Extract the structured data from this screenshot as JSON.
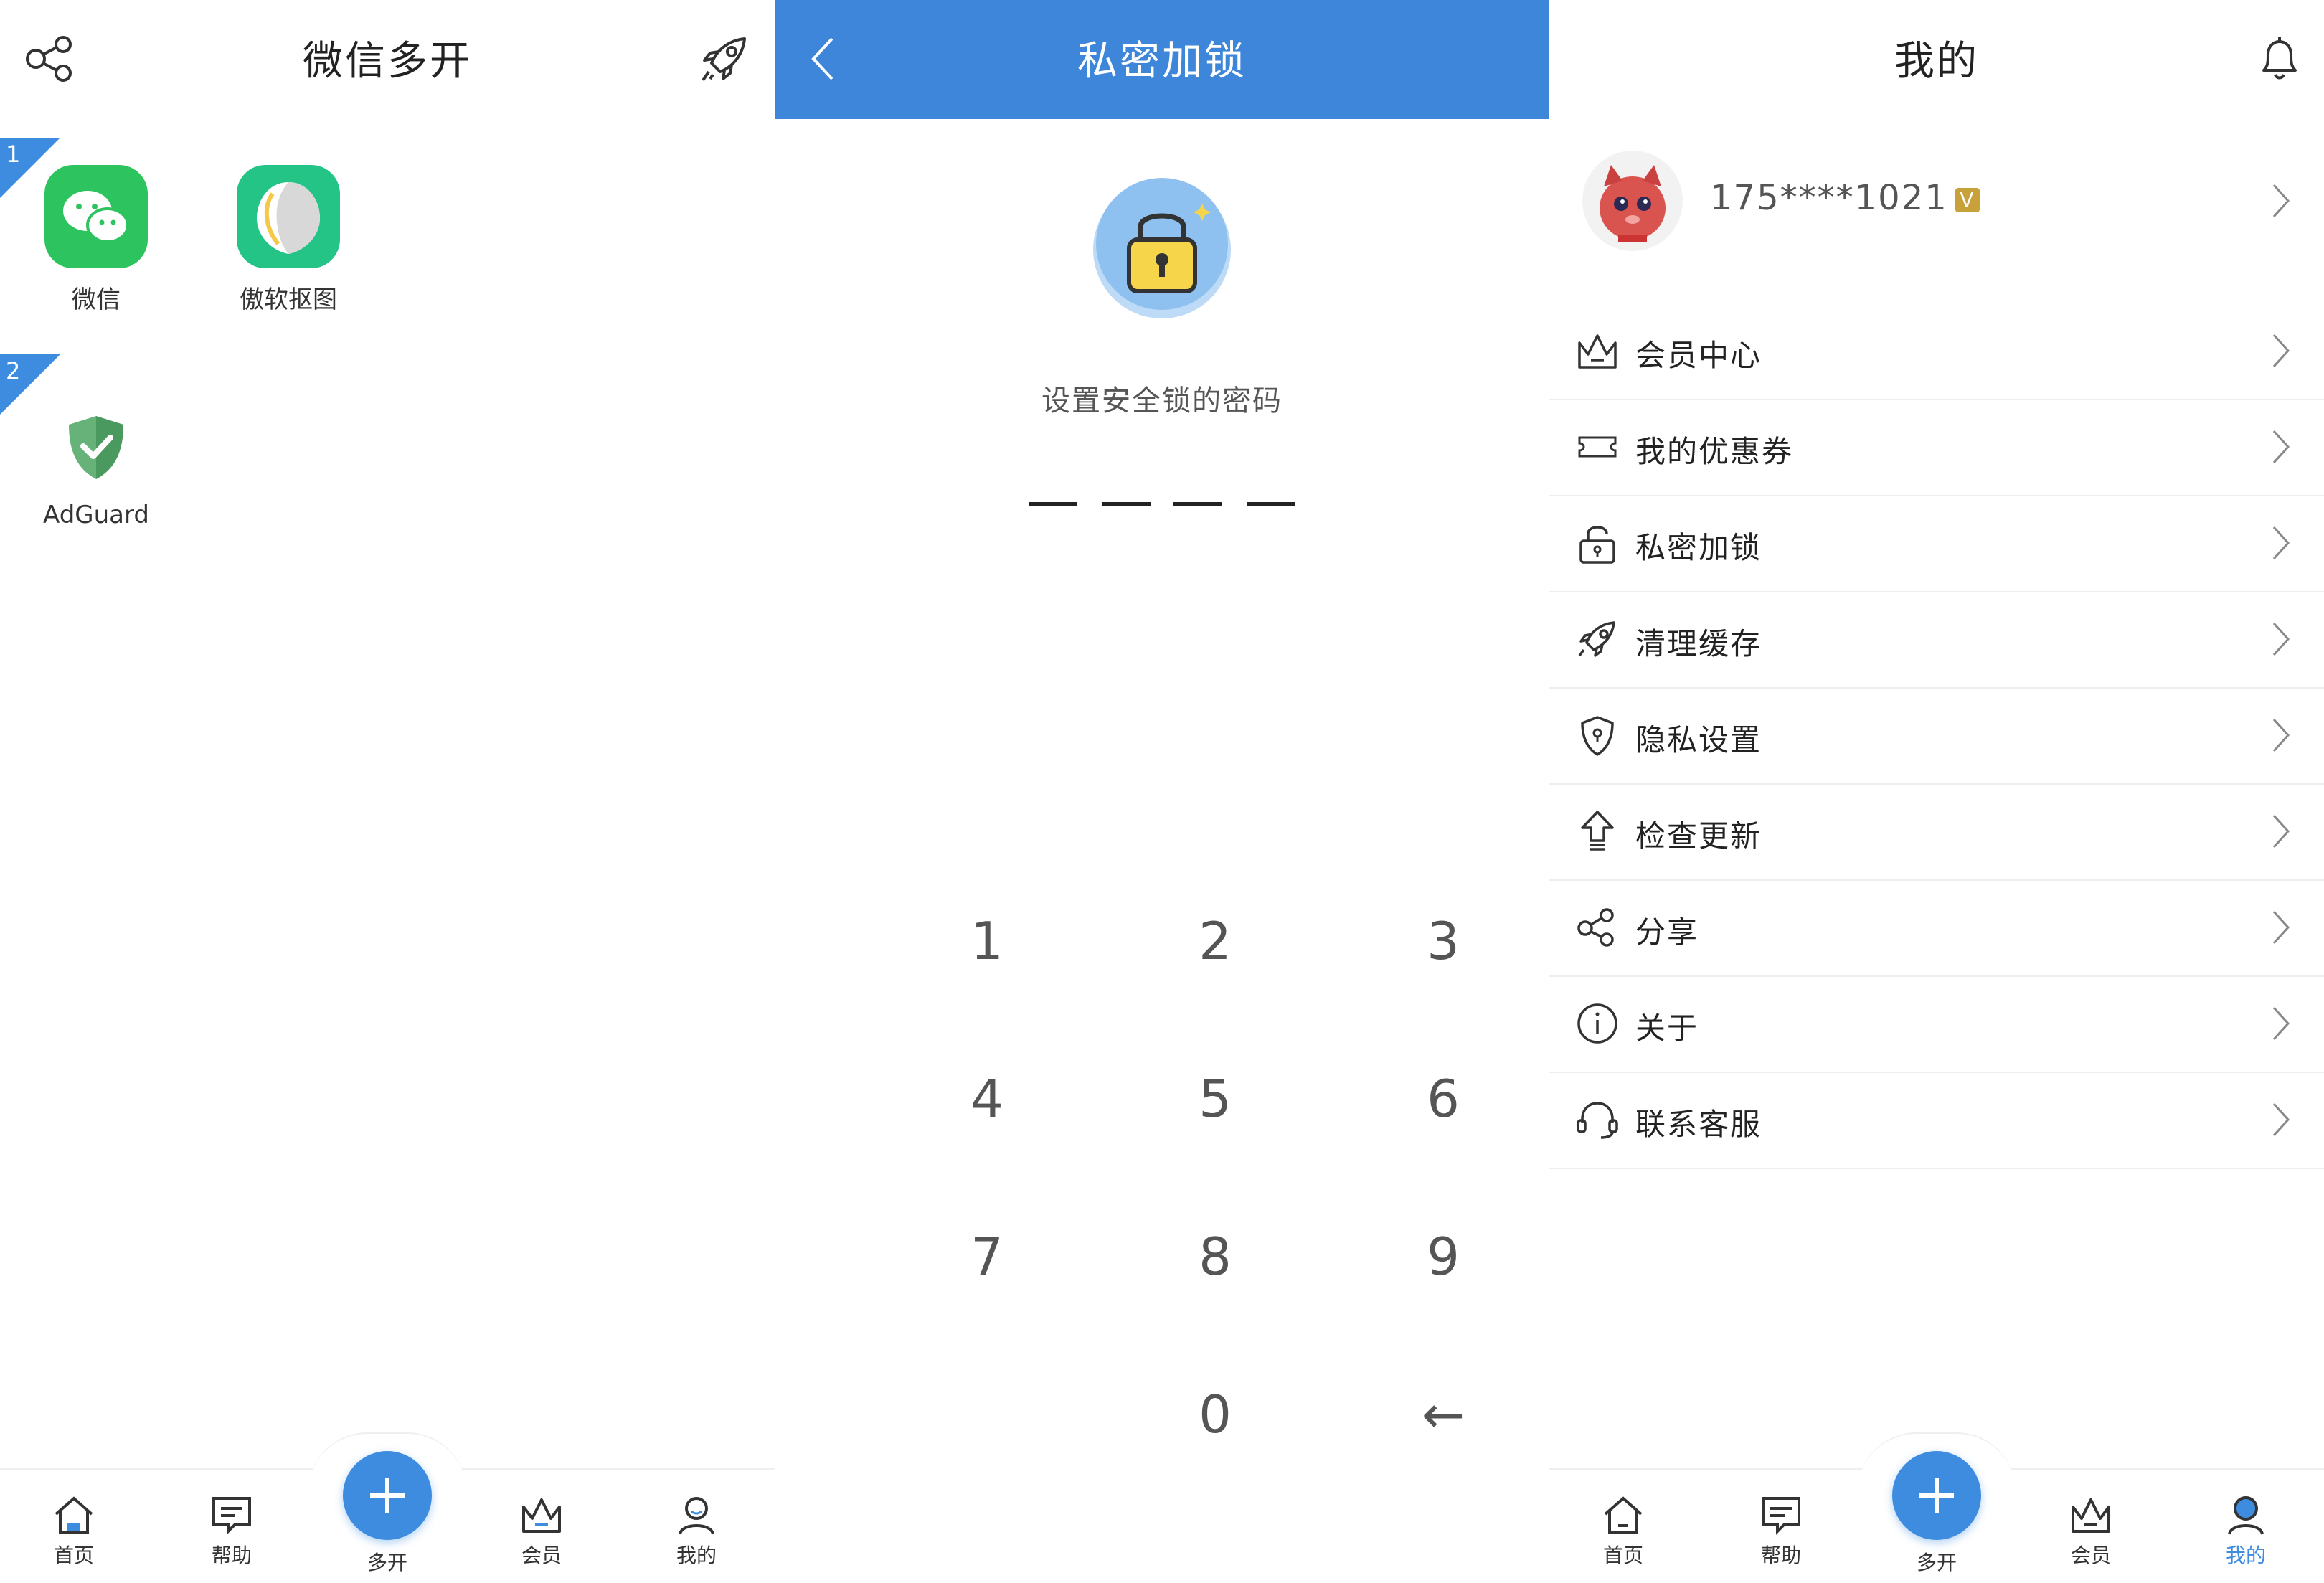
{
  "screen1": {
    "title": "微信多开",
    "groups": [
      {
        "badge": "1",
        "apps": [
          {
            "name": "微信",
            "icon": "wechat-icon"
          },
          {
            "name": "傲软抠图",
            "icon": "apowersoft-cutout-icon"
          }
        ]
      },
      {
        "badge": "2",
        "apps": [
          {
            "name": "AdGuard",
            "icon": "adguard-shield-icon"
          }
        ]
      }
    ]
  },
  "screen2": {
    "title": "私密加锁",
    "hint": "设置安全锁的密码",
    "keys": [
      "1",
      "2",
      "3",
      "4",
      "5",
      "6",
      "7",
      "8",
      "9",
      "0"
    ],
    "backspace": "←"
  },
  "screen3": {
    "title": "我的",
    "phone": "175****1021",
    "vip_badge": "V",
    "menu": [
      {
        "label": "会员中心",
        "icon": "crown-icon"
      },
      {
        "label": "我的优惠券",
        "icon": "coupon-icon"
      },
      {
        "label": "私密加锁",
        "icon": "lock-icon"
      },
      {
        "label": "清理缓存",
        "icon": "rocket-icon"
      },
      {
        "label": "隐私设置",
        "icon": "shield-icon"
      },
      {
        "label": "检查更新",
        "icon": "upload-arrow-icon"
      },
      {
        "label": "分享",
        "icon": "share-icon"
      },
      {
        "label": "关于",
        "icon": "info-icon"
      },
      {
        "label": "联系客服",
        "icon": "headset-icon"
      }
    ]
  },
  "tabbar": {
    "items": [
      "首页",
      "帮助",
      "多开",
      "会员",
      "我的"
    ],
    "active_color": "#3d8ce0"
  },
  "colors": {
    "brand_blue": "#3d86d9",
    "wechat_green": "#2dc35f"
  }
}
